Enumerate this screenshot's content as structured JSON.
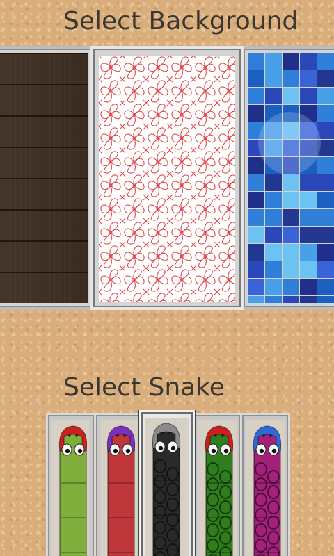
{
  "background_section": {
    "title": "Select Background",
    "options": [
      {
        "name": "Dark wood",
        "selected": false
      },
      {
        "name": "Red floral",
        "selected": true
      },
      {
        "name": "Blue tiles",
        "selected": false
      }
    ]
  },
  "snake_section": {
    "title": "Select Snake",
    "options": [
      {
        "name": "Green",
        "body_color": "#7fae3c",
        "head_color": "#cc2020",
        "selected": false
      },
      {
        "name": "Red",
        "body_color": "#c0373b",
        "head_color": "#7a2fc4",
        "selected": false
      },
      {
        "name": "Black",
        "body_color": "#2a2a2a",
        "head_color": "#8a8a8a",
        "selected": true
      },
      {
        "name": "Green patterned",
        "body_color": "#2f7d1d",
        "head_color": "#cc2020",
        "selected": false
      },
      {
        "name": "Magenta patterned",
        "body_color": "#a4217b",
        "head_color": "#2a6bd8",
        "selected": false
      }
    ]
  }
}
